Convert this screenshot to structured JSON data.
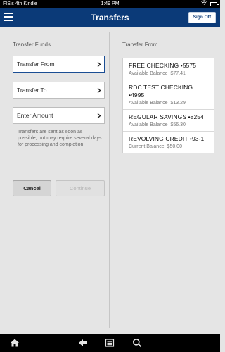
{
  "status_bar": {
    "device_name": "FIS's 4th Kindle",
    "time": "1:49 PM",
    "icons": [
      "wifi-icon",
      "battery-icon"
    ]
  },
  "app_bar": {
    "title": "Transfers",
    "sign_off_label": "Sign Off",
    "menu_icon": "hamburger-menu-icon"
  },
  "transfer_form": {
    "section_title": "Transfer Funds",
    "transfer_from_label": "Transfer From",
    "transfer_to_label": "Transfer To",
    "amount_label": "Enter Amount",
    "note": "Transfers are sent as soon as possible, but may require several days for processing and completion.",
    "cancel_label": "Cancel",
    "continue_label": "Continue"
  },
  "accounts_panel": {
    "section_title": "Transfer From",
    "accounts": [
      {
        "name": "FREE CHECKING •5575",
        "balance_label": "Available Balance",
        "balance": "$77.41"
      },
      {
        "name": "RDC TEST CHECKING •4995",
        "balance_label": "Available Balance",
        "balance": "$13.29"
      },
      {
        "name": "REGULAR SAVINGS •8254",
        "balance_label": "Available Balance",
        "balance": "$56.30"
      },
      {
        "name": "REVOLVING CREDIT •93-1",
        "balance_label": "Current Balance",
        "balance": "$50.00"
      }
    ]
  },
  "nav_bar": {
    "icons": [
      "home-icon",
      "back-icon",
      "menu-icon",
      "search-icon"
    ]
  },
  "colors": {
    "app_bar": "#0b3a78",
    "background": "#e5e5e5",
    "active_border": "#1b4e94"
  }
}
